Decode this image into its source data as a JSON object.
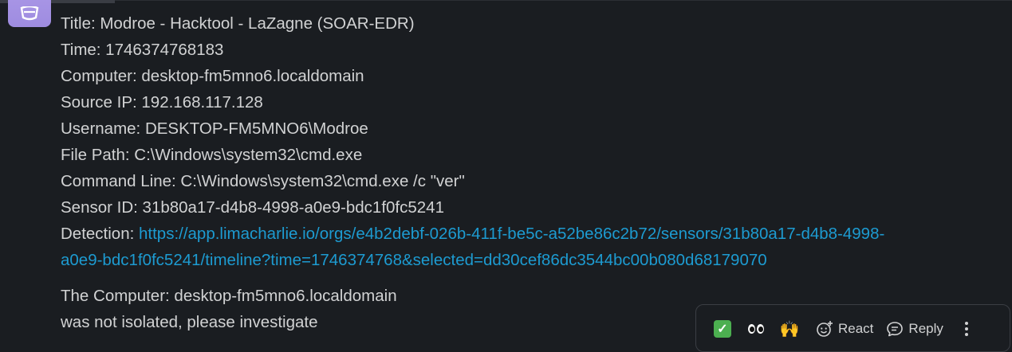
{
  "message": {
    "lines": [
      "Title: Modroe - Hacktool - LaZagne (SOAR-EDR)",
      "Time: 1746374768183",
      "Computer: desktop-fm5mno6.localdomain",
      "Source IP: 192.168.117.128",
      "Username: DESKTOP-FM5MNO6\\Modroe",
      "File Path: C:\\Windows\\system32\\cmd.exe",
      "Command Line: C:\\Windows\\system32\\cmd.exe /c \"ver\"",
      "Sensor ID: 31b80a17-d4b8-4998-a0e9-bdc1f0fc5241"
    ],
    "detection_label": "Detection: ",
    "detection_link_line1": "https://app.limacharlie.io/orgs/e4b2debf-026b-411f-be5c-a52be86c2b72/sensors/31b80a17-d4b8-4998-",
    "detection_link_line2": "a0e9-bdc1f0fc5241/timeline?time=1746374768&selected=dd30cef86dc3544bc00b080d68179070",
    "footer_line1": "The Computer: desktop-fm5mno6.localdomain",
    "footer_line2": "was not isolated, please investigate"
  },
  "actions": {
    "quick_reactions": [
      "white-check-mark",
      "eyes",
      "raised-hands"
    ],
    "react_label": "React",
    "reply_label": "Reply"
  },
  "colors": {
    "background": "#1a1d21",
    "text": "#d1d2d3",
    "link": "#1d9bd1",
    "avatar": "#a996e6"
  }
}
